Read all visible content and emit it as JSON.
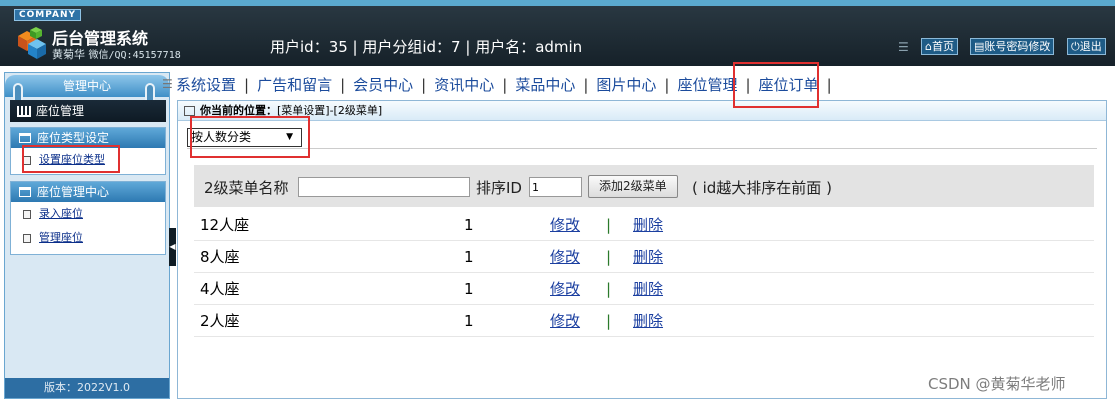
{
  "header": {
    "company_label": "COMPANY",
    "system_title": "后台管理系统",
    "author_name": "黄菊华",
    "author_contact": "微信/QQ:45157718",
    "user_info": "用户id：35 | 用户分组id：7 | 用户名：admin",
    "buttons": {
      "home": "首页",
      "password": "账号密码修改",
      "logout": "退出"
    }
  },
  "sidebar": {
    "title": "管理中心",
    "current": "座位管理",
    "groups": [
      {
        "title": "座位类型设定",
        "items": [
          "设置座位类型"
        ]
      },
      {
        "title": "座位管理中心",
        "items": [
          "录入座位",
          "管理座位"
        ]
      }
    ],
    "version": "版本：2022V1.0"
  },
  "nav": {
    "items": [
      "系统设置",
      "广告和留言",
      "会员中心",
      "资讯中心",
      "菜品中心",
      "图片中心",
      "座位管理",
      "座位订单"
    ],
    "active": "座位管理"
  },
  "breadcrumb": {
    "label": "你当前的位置：",
    "path": "[菜单设置]-[2级菜单]"
  },
  "category_select": {
    "selected": "按人数分类"
  },
  "add_form": {
    "name_label": "2级菜单名称",
    "name_value": "",
    "sort_label": "排序ID",
    "sort_value": "1",
    "add_button": "添加2级菜单",
    "hint": "( id越大排序在前面 )"
  },
  "table": {
    "edit_label": "修改",
    "delete_label": "删除",
    "rows": [
      {
        "name": "12人座",
        "sort": "1"
      },
      {
        "name": "8人座",
        "sort": "1"
      },
      {
        "name": "4人座",
        "sort": "1"
      },
      {
        "name": "2人座",
        "sort": "1"
      }
    ]
  },
  "watermark": "CSDN @黄菊华老师",
  "colors": {
    "header_bg": "#1c2a33",
    "accent_blue": "#2d79b2",
    "link": "#1b3fa0",
    "highlight": "#e03030"
  }
}
